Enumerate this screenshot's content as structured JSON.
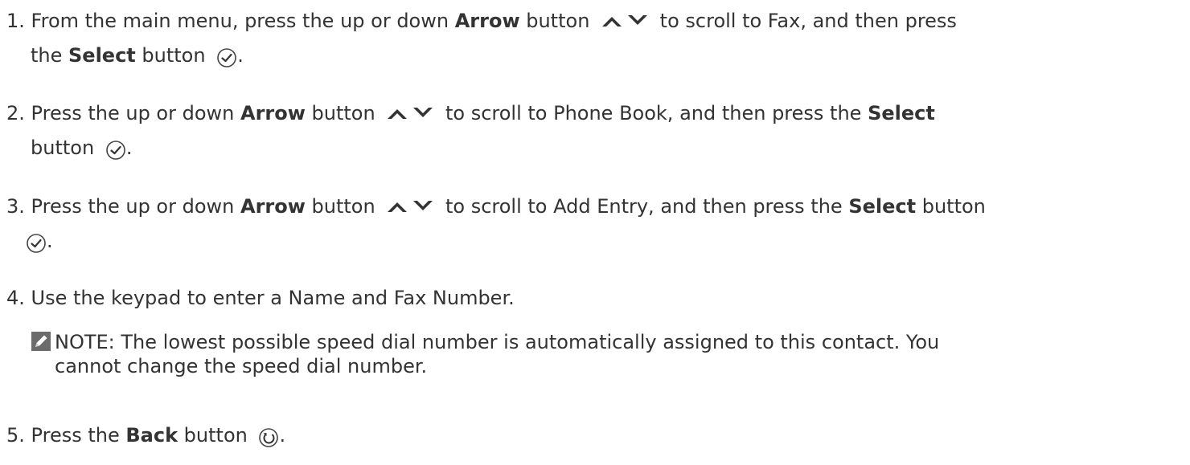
{
  "steps": [
    {
      "number": "1.",
      "line1": {
        "pre": "From the main menu, press the up or down ",
        "bold": "Arrow",
        "mid": " button",
        "post": " to scroll to Fax, and then press"
      },
      "line2": {
        "pre": "the ",
        "bold": "Select",
        "mid": " button",
        "post": "."
      }
    },
    {
      "number": "2.",
      "line1": {
        "pre": "Press the up or down ",
        "bold": "Arrow",
        "mid": " button",
        "post": " to scroll to Phone Book, and then press the ",
        "bold2": "Select"
      },
      "line2": {
        "pre": "button",
        "post": "."
      }
    },
    {
      "number": "3.",
      "line1": {
        "pre": "Press the up or down ",
        "bold": "Arrow",
        "mid": " button",
        "post": " to scroll to Add Entry, and then press the ",
        "bold2": "Select",
        "end": " button"
      },
      "line2": {
        "post": "."
      }
    },
    {
      "number": "4.",
      "text": "Use the keypad to enter a Name and Fax Number."
    },
    {
      "number": "5.",
      "line1": {
        "pre": "Press the ",
        "bold": "Back",
        "mid": " button",
        "post": "."
      }
    }
  ],
  "note": {
    "icon": "pencil-note-icon",
    "line1": "NOTE: The lowest possible speed dial number is automatically assigned to this contact. You",
    "line2": "cannot change the speed dial number."
  },
  "colors": {
    "text": "#333333",
    "icon": "#3a3a3a",
    "background": "#ffffff"
  }
}
